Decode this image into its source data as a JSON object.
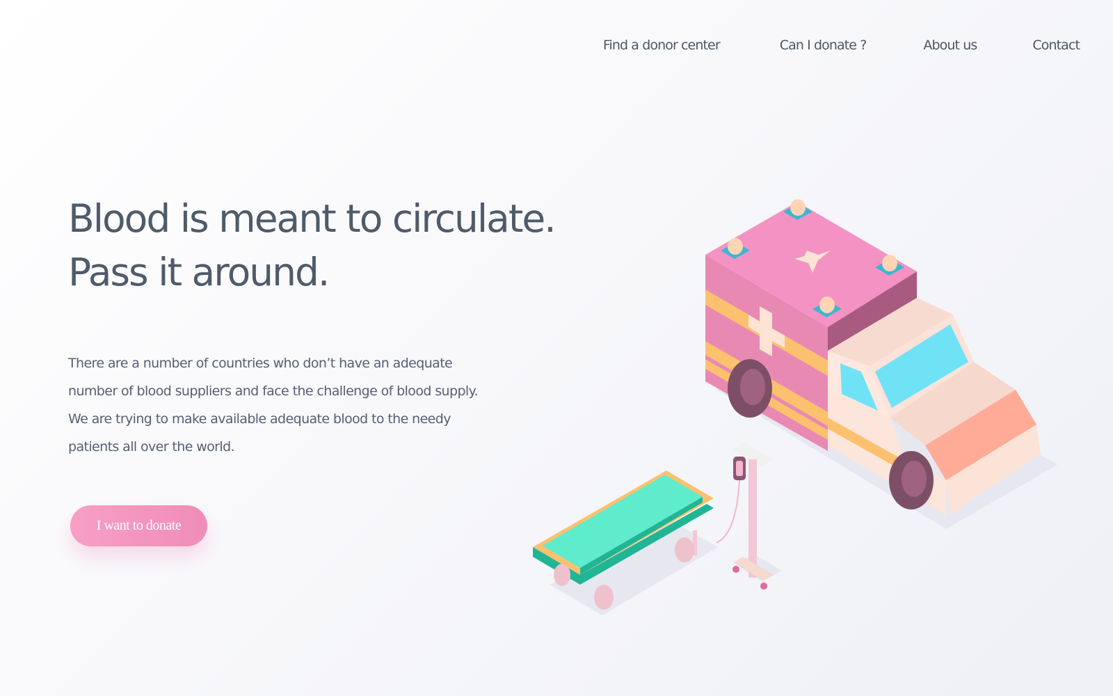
{
  "nav": {
    "items": [
      {
        "label": "Find a donor center"
      },
      {
        "label": "Can I donate ?"
      },
      {
        "label": "About us"
      },
      {
        "label": "Contact"
      }
    ]
  },
  "hero": {
    "headline_line1": "Blood is meant to circulate.",
    "headline_line2": "Pass it around.",
    "description": "There are a number of countries who don’t have an adequate number of blood suppliers and face the challenge of blood supply. We are trying to make available adequate blood to the needy patients all over the world.",
    "cta_label": "I want to donate"
  },
  "colors": {
    "headline": "#4f5b6a",
    "body_text": "#565e72",
    "cta_gradient_start": "#f79fc6",
    "cta_gradient_end": "#ef8db8"
  }
}
